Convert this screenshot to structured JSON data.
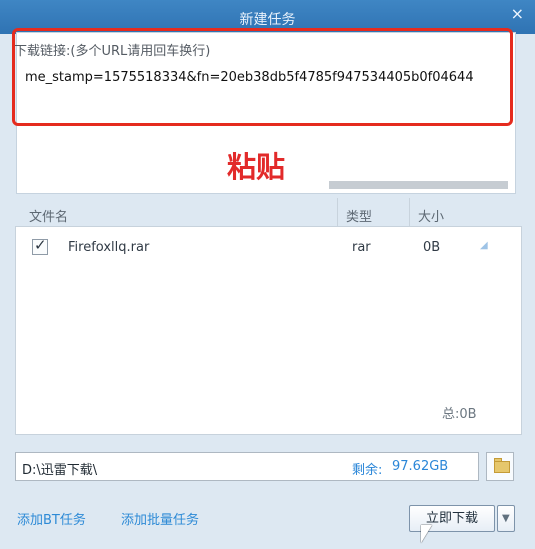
{
  "window": {
    "title": "新建任务",
    "close_label": "×"
  },
  "url_panel": {
    "label": "下载链接:(多个URL请用回车换行)",
    "value": "me_stamp=1575518334&fn=20eb38db5f4785f947534405b0f04644"
  },
  "overlay": {
    "text": "粘贴"
  },
  "file_table": {
    "headers": [
      "文件名",
      "类型",
      "大小"
    ],
    "rows": [
      {
        "name": "Firefoxllq.rar",
        "type": "rar",
        "size": "0B",
        "checked": true
      }
    ],
    "total": "总:0B"
  },
  "save_path": {
    "path": "D:\\迅雷下载\\",
    "remain_label": "剩余:",
    "remain_value": "97.62GB"
  },
  "actions": {
    "bt_task": "添加BT任务",
    "batch_task": "添加批量任务",
    "download_now": "立即下载"
  },
  "colors": {
    "titlebar": "#2f73b3",
    "highlight_box": "#e52b1e",
    "link": "#2d8ad6"
  },
  "icons": {
    "close": "close-icon",
    "checkbox": "check-icon",
    "sort": "sort-icon",
    "folder": "folder-icon",
    "dropdown": "chevron-down-icon",
    "cursor": "mouse-cursor-icon"
  }
}
